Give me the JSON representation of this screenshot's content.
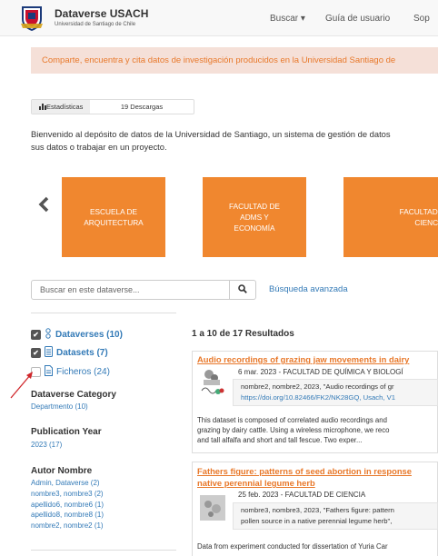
{
  "header": {
    "brand_title": "Dataverse USACH",
    "brand_subtitle": "Universidad de Santiago de Chile",
    "nav": [
      {
        "label": "Buscar ▾"
      },
      {
        "label": "Guía de usuario"
      },
      {
        "label": "Sop"
      }
    ]
  },
  "banner": {
    "text": "Comparte, encuentra y cita datos de investigación producidos en la Universidad Santiago de"
  },
  "stats": {
    "label": "Estadísticas",
    "downloads": "19 Descargas"
  },
  "welcome": "Bienvenido al depósito de datos de la Universidad de Santiago, un sistema de gestión de datos sus datos o trabajar en un proyecto.",
  "welcome_lines": [
    "Bienvenido al depósito de datos de la Universidad de Santiago, un sistema de gestión de datos",
    "sus datos o trabajar en un proyecto."
  ],
  "carousel": {
    "tiles": [
      {
        "label": "ESCUELA DE ARQUITECTURA"
      },
      {
        "label": "FACULTAD DE ADMS Y ECONOMÍA"
      },
      {
        "label": "FACULTAD D CIENCIA"
      }
    ]
  },
  "search": {
    "placeholder": "Buscar en este dataverse...",
    "advanced": "Búsqueda avanzada"
  },
  "facets": {
    "types": [
      {
        "label": "Dataverses (10)",
        "checked": true
      },
      {
        "label": "Datasets (7)",
        "checked": true
      },
      {
        "label": "Ficheros (24)",
        "checked": false
      }
    ],
    "category": {
      "title": "Dataverse Category",
      "items": [
        "Departmento (10)"
      ]
    },
    "year": {
      "title": "Publication Year",
      "items": [
        "2023 (17)"
      ]
    },
    "author": {
      "title": "Autor Nombre",
      "items": [
        "Admin, Dataverse (2)",
        "nombre3, nombre3 (2)",
        "apellido6, nombre6 (1)",
        "apellido8, nombre8 (1)",
        "nombre2, nombre2 (1)"
      ]
    }
  },
  "results": {
    "count": "1 a 10 de 17 Resultados",
    "items": [
      {
        "title": "Audio recordings of grazing jaw movements in dairy",
        "meta": "6 mar. 2023 - FACULTAD DE QUÍMICA Y BIOLOGÍ",
        "cite1": "nombre2, nombre2, 2023, \"Audio recordings of gr",
        "cite2": "https://doi.org/10.82466/FK2/NK28GQ, Usach, V1",
        "desc": [
          "This dataset is composed of correlated audio recordings and",
          "grazing by dairy cattle. Using a wireless microphone, we reco",
          "and tall alfalfa and short and tall fescue. Two exper..."
        ]
      },
      {
        "title": "Fathers figure: patterns of seed abortion in response",
        "title2": "native perennial legume herb",
        "meta": "25 feb. 2023 - FACULTAD DE CIENCIA",
        "cite1": "nombre3, nombre3, 2023, \"Fathers figure: pattern",
        "cite2": "pollen source in a native perennial legume herb\",",
        "desc": [
          "Data from experiment conducted for dissertation of Yuria Car"
        ]
      }
    ]
  },
  "colors": {
    "accent": "#f0872f",
    "link": "#337ab7",
    "banner_text": "#e8782a",
    "annotation_arrow": "#d0262b"
  }
}
